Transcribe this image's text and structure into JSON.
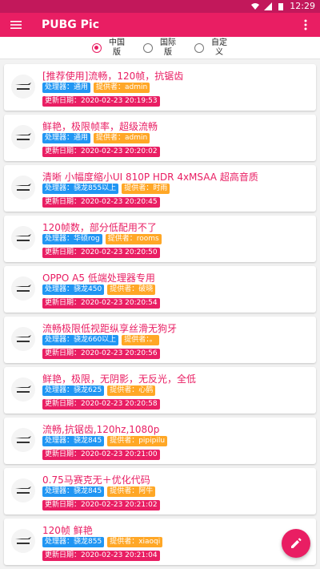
{
  "status": {
    "time": "12:29"
  },
  "appbar": {
    "title": "PUBG Pic"
  },
  "tabs": [
    {
      "label": "中国版",
      "selected": true
    },
    {
      "label": "国际版",
      "selected": false
    },
    {
      "label": "自定义",
      "selected": false
    }
  ],
  "cards": [
    {
      "title": "[推荐使用]流畅，120帧，抗锯齿",
      "processor": "处理器：通用",
      "provider": "提供者：admin",
      "date": "更新日期：2020-02-23 20:19:53"
    },
    {
      "title": "鲜艳，极限帧率，超级流畅",
      "processor": "处理器：通用",
      "provider": "提供者：admin",
      "date": "更新日期：2020-02-23 20:20:02"
    },
    {
      "title": "清晰 小幅度缩小UI 810P HDR 4xMSAA 超高音质",
      "processor": "处理器：骁龙855以上",
      "provider": "提供者：时雨",
      "date": "更新日期：2020-02-23 20:20:45"
    },
    {
      "title": "120帧数，部分低配用不了",
      "processor": "处理器：华硕rog",
      "provider": "提供者：rooms",
      "date": "更新日期：2020-02-23 20:20:50"
    },
    {
      "title": "OPPO A5 低端处理器专用",
      "processor": "处理器：骁龙450",
      "provider": "提供者：破晓",
      "date": "更新日期：2020-02-23 20:20:54"
    },
    {
      "title": "流畅极限低视距纵享丝滑无狗牙",
      "processor": "处理器：骁龙660以上",
      "provider": "提供者：。",
      "date": "更新日期：2020-02-23 20:20:56"
    },
    {
      "title": "鲜艳，极限，无阴影，无反光，全低",
      "processor": "处理器：骁龙625",
      "provider": "提供者：心鹤",
      "date": "更新日期：2020-02-23 20:20:58"
    },
    {
      "title": "流畅,抗锯齿,120hz,1080p",
      "processor": "处理器：骁龙845",
      "provider": "提供者：pipipilu",
      "date": "更新日期：2020-02-23 20:21:00"
    },
    {
      "title": "0.75马赛克无＋优化代码",
      "processor": "处理器：骁龙845",
      "provider": "提供者：阿牛",
      "date": "更新日期：2020-02-23 20:21:02"
    },
    {
      "title": "120帧 鲜艳",
      "processor": "处理器：骁龙855",
      "provider": "提供者：xiaoqi",
      "date": "更新日期：2020-02-23 20:21:04"
    }
  ],
  "icons": {
    "menu": "menu-icon",
    "more": "more-vert-icon",
    "thumb": "plane-icon",
    "fab": "edit-icon"
  },
  "colors": {
    "primary": "#e91e63",
    "blue_tag": "#2196f3",
    "orange_tag": "#ffa726"
  }
}
